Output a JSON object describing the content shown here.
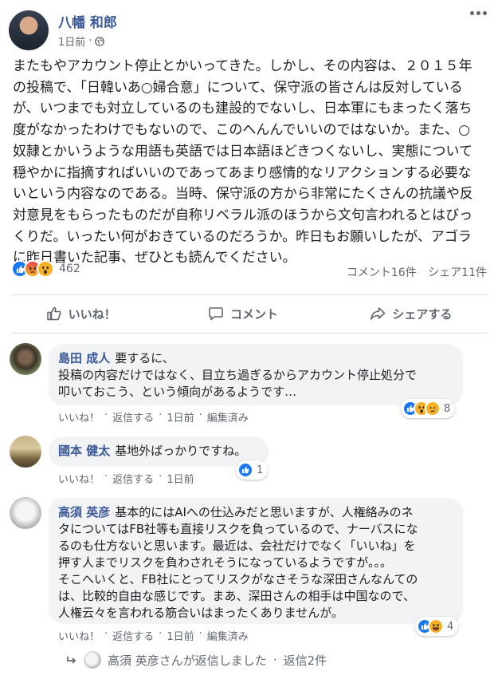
{
  "post": {
    "author": "八幡 和郎",
    "time": "1日前",
    "separator": "·",
    "text": "またもやアカウント停止とかいってきた。しかし、その内容は、２０１５年\nの投稿で、「日韓いあ○婦合意」について、保守派の皆さんは反対している\nが、いつまでも対立しているのも建設的でないし、日本軍にもまったく落ち\n度がなかったわけでもないので、このへんんでいいのではないか。また、○\n奴隷とかいうような用語も英語では日本語ほどきつくないし、実態について\n穏やかに指摘すればいいのであってあまり感情的なリアクションする必要な\nいという内容なのである。当時、保守派の方から非常にたくさんの抗議や反\n対意見をもらったものだが自称リベラル派のほうから文句言われるとはびっ\nくりだ。いったい何がおきているのだろうか。昨日もお願いしたが、アゴラ\nに昨日書いた記事、ぜひとも読んでください。",
    "reaction_count": "462",
    "comments_count": "コメント16件",
    "shares_count": "シェア11件"
  },
  "actions": {
    "like": "いいね！",
    "comment": "コメント",
    "share": "シェアする"
  },
  "comments": [
    {
      "name": "島田 成人",
      "text": "要するに、\n投稿の内容だけではなく、目立ち過ぎるからアカウント停止処分で\n叩いておこう、という傾向があるようです…",
      "like": "いいね！",
      "reply": "返信する",
      "time": "1日前",
      "edited": "編集済み",
      "reaction_count": "8"
    },
    {
      "name": "國本 健太",
      "text": "基地外ばっかりですね。",
      "like": "いいね！",
      "reply": "返信する",
      "time": "1日前",
      "reaction_count": "1"
    },
    {
      "name": "高須 英彦",
      "text": "基本的にはAIへの仕込みだと思いますが、人権絡みのネ\nタについてはFB社等も直接リスクを負っているので、ナーバスにな\nるのも仕方ないと思います。最近は、会社だけでなく「いいね」を\n押す人までリスクを負わされそうになっているようですが。。。\nそこへいくと、FB社にとってリスクがなさそうな深田さんなんての\nは、比較的自由な感じです。まあ、深田さんの相手は中国なので、\n人権云々を言われる筋合いはまったくありませんが。",
      "like": "いいね！",
      "reply": "返信する",
      "time": "1日前",
      "edited": "編集済み",
      "reaction_count": "4"
    }
  ],
  "reply_summary": {
    "text": "高須 英彦さんが返信しました",
    "separator": "·",
    "count": "返信2件"
  },
  "colors": {
    "brand_link": "#385898",
    "like_blue": "#1877f2",
    "muted": "#606770",
    "bubble": "#f2f3f5"
  }
}
